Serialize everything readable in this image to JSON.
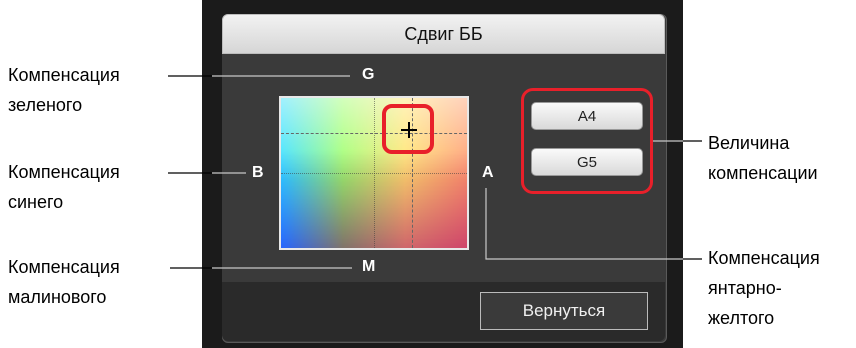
{
  "dialog": {
    "title": "Сдвиг ББ",
    "back_button": "Вернуться"
  },
  "axes": {
    "top": "G",
    "bottom": "M",
    "left": "B",
    "right": "A"
  },
  "values": {
    "amber": "A4",
    "green": "G5"
  },
  "callouts": {
    "green_line1": "Компенсация",
    "green_line2": "зеленого",
    "blue_line1": "Компенсация",
    "blue_line2": "синего",
    "magenta_line1": "Компенсация",
    "magenta_line2": "малинового",
    "value_line1": "Величина",
    "value_line2": "компенсации",
    "amber_line1": "Компенсация",
    "amber_line2": "янтарно-",
    "amber_line3": "желтого"
  },
  "colors": {
    "highlight": "#e8202a"
  }
}
